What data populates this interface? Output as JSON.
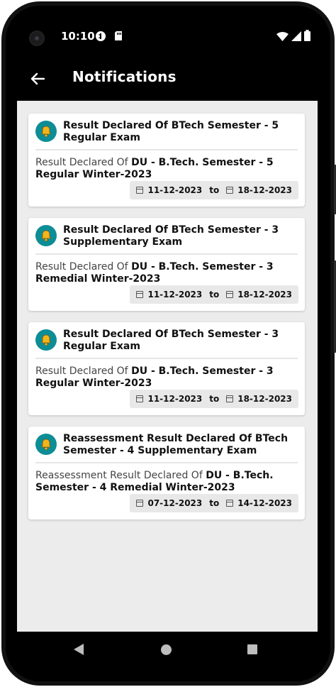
{
  "status_bar": {
    "time": "10:10",
    "icons": [
      "camera-cutout",
      "game-controller-icon",
      "sd-card-icon",
      "wifi-icon",
      "signal-icon",
      "battery-icon"
    ]
  },
  "app_bar": {
    "title": "Notifications",
    "back_icon": "arrow-left-icon"
  },
  "colors": {
    "accent": "#0d8d96",
    "bell_icon": "#f3b51c",
    "screen_bg": "#ececec",
    "app_bar": "#000000"
  },
  "notifications": [
    {
      "title": "Result Declared Of BTech Semester - 5 Regular Exam",
      "message_prefix": "Result Declared Of ",
      "message_bold": "DU - B.Tech. Semester - 5 Regular Winter-2023",
      "from_date": "11-12-2023",
      "to_label": "to",
      "to_date": "18-12-2023"
    },
    {
      "title": "Result Declared Of BTech Semester - 3 Supplementary Exam",
      "message_prefix": "Result Declared Of ",
      "message_bold": "DU - B.Tech. Semester - 3 Remedial Winter-2023",
      "from_date": "11-12-2023",
      "to_label": "to",
      "to_date": "18-12-2023"
    },
    {
      "title": "Result Declared Of BTech Semester - 3 Regular Exam",
      "message_prefix": "Result Declared Of ",
      "message_bold": "DU - B.Tech. Semester - 3 Regular Winter-2023",
      "from_date": "11-12-2023",
      "to_label": "to",
      "to_date": "18-12-2023"
    },
    {
      "title": "Reassessment Result Declared Of BTech Semester - 4 Supplementary Exam",
      "message_prefix": "Reassessment Result Declared Of ",
      "message_bold": "DU - B.Tech. Semester - 4 Remedial Winter-2023",
      "from_date": "07-12-2023",
      "to_label": "to",
      "to_date": "14-12-2023"
    }
  ],
  "nav_bar": {
    "icons": [
      "back-triangle-icon",
      "home-circle-icon",
      "recents-square-icon"
    ]
  }
}
